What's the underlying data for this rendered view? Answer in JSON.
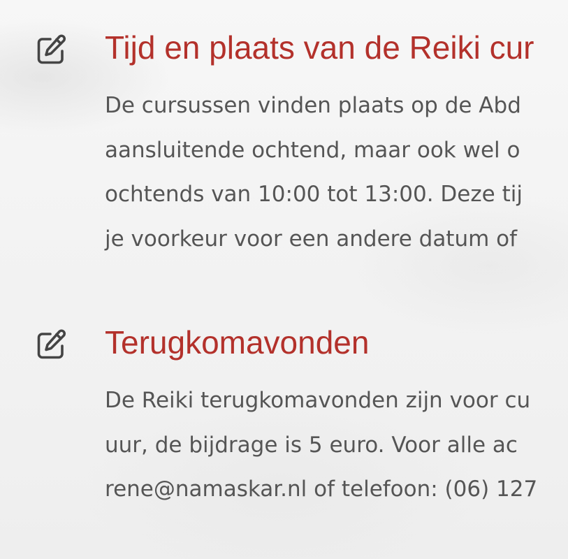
{
  "sections": [
    {
      "icon": "edit-icon",
      "title": "Tijd en plaats van de Reiki cur",
      "lines": [
        "De cursussen vinden plaats op de Abd",
        "aansluitende ochtend, maar ook wel o",
        "ochtends van 10:00 tot 13:00. Deze tij",
        "je voorkeur voor een andere datum of"
      ]
    },
    {
      "icon": "edit-icon",
      "title": "Terugkomavonden",
      "lines": [
        "De Reiki terugkomavonden zijn voor cu",
        "uur, de bijdrage is 5 euro. Voor alle ac",
        "rene@namaskar.nl of telefoon: (06) 127"
      ]
    }
  ],
  "colors": {
    "title": "#b3312b",
    "text": "#555555",
    "icon": "#444444"
  }
}
